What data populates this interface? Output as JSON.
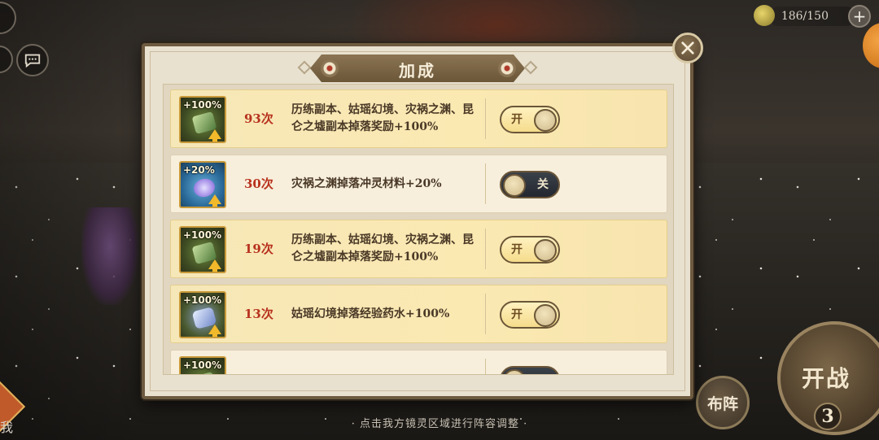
{
  "stamina": {
    "value": "186/150",
    "plus": "+"
  },
  "dialog": {
    "title": "加成",
    "rows": [
      {
        "count": "93次",
        "desc": "历练副本、姑瑶幻境、灾祸之渊、昆仑之墟副本掉落奖励+100%",
        "icon_pct": "+100%",
        "icon": "green-scroll-icon",
        "toggle": "开",
        "state": "on"
      },
      {
        "count": "30次",
        "desc": "灾祸之渊掉落冲灵材料+20%",
        "icon_pct": "+20%",
        "icon": "blue-orb-icon",
        "toggle": "关",
        "state": "off"
      },
      {
        "count": "19次",
        "desc": "历练副本、姑瑶幻境、灾祸之渊、昆仑之墟副本掉落奖励+100%",
        "icon_pct": "+100%",
        "icon": "green-scroll-icon",
        "toggle": "开",
        "state": "on"
      },
      {
        "count": "13次",
        "desc": "姑瑶幻境掉落经验药水+100%",
        "icon_pct": "+100%",
        "icon": "potion-icon",
        "toggle": "开",
        "state": "on"
      },
      {
        "count": "",
        "desc": "",
        "icon_pct": "+100%",
        "icon": "green-scroll-icon",
        "toggle": "",
        "state": "off"
      }
    ]
  },
  "hint": "· 点击我方镜灵区域进行阵容调整 ·",
  "left_label": "我",
  "formation": "布阵",
  "battle": {
    "label": "开战",
    "count": "3"
  }
}
